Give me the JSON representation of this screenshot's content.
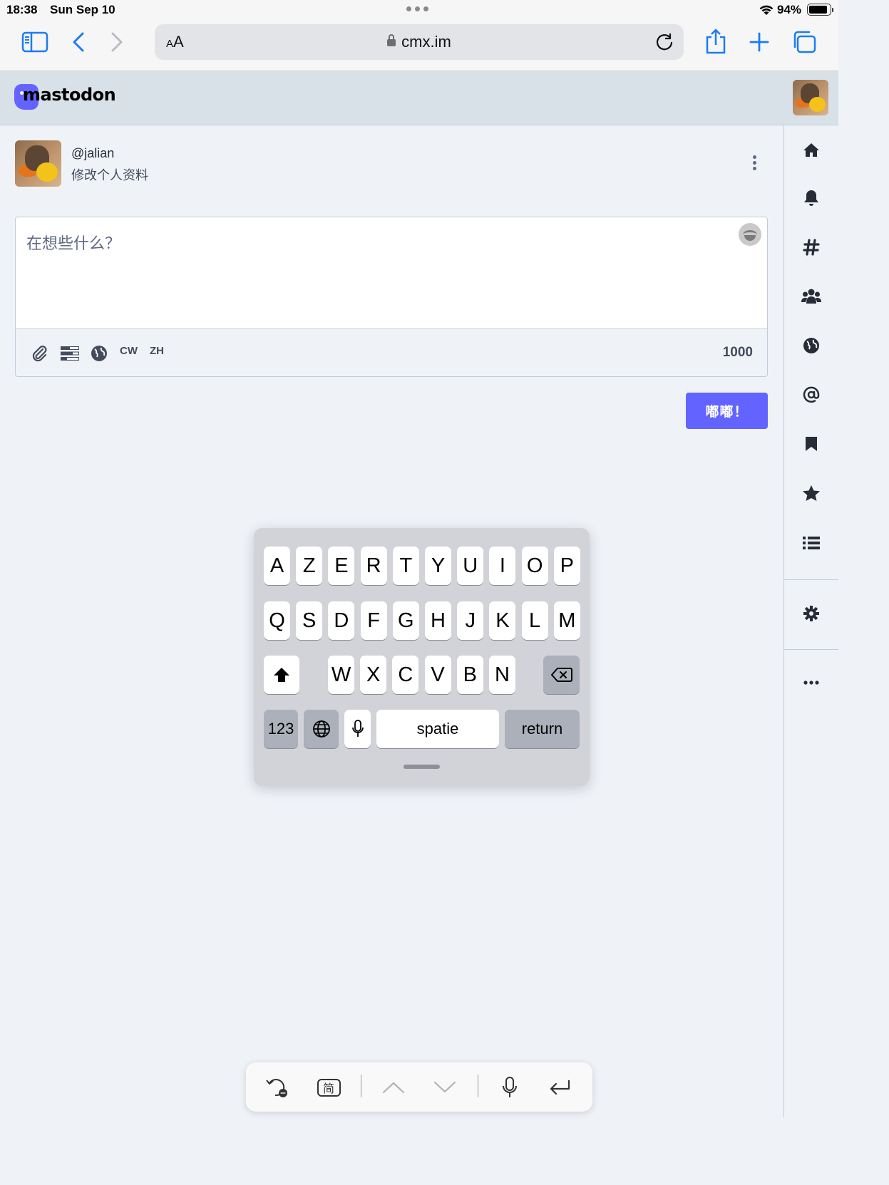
{
  "status_bar": {
    "time": "18:38",
    "date": "Sun Sep 10",
    "battery_pct": "94%",
    "battery_level": 0.94
  },
  "safari": {
    "text_size_label_small": "A",
    "text_size_label_large": "A",
    "domain": "cmx.im",
    "icons": [
      "sidebar-icon",
      "back-icon",
      "forward-icon",
      "lock-icon",
      "reload-icon",
      "share-icon",
      "new-tab-icon",
      "tabs-icon"
    ]
  },
  "mastodon": {
    "logo_text": "mastodon",
    "brand_color": "#6364ff"
  },
  "account": {
    "handle": "@jalian",
    "edit_profile": "修改个人资料"
  },
  "compose": {
    "placeholder": "在想些什么？",
    "cw_label": "CW",
    "lang_label": "ZH",
    "char_counter": "1000",
    "submit_label": "嘟嘟！",
    "option_icons": [
      "paperclip-icon",
      "poll-icon",
      "globe-icon"
    ]
  },
  "right_nav": {
    "items": [
      "home-icon",
      "bell-icon",
      "hashtag-icon",
      "users-icon",
      "globe-icon",
      "at-icon",
      "bookmark-icon",
      "star-icon",
      "list-icon",
      "gear-icon",
      "ellipsis-icon"
    ]
  },
  "keyboard": {
    "row1": [
      "A",
      "Z",
      "E",
      "R",
      "T",
      "Y",
      "U",
      "I",
      "O",
      "P"
    ],
    "row2": [
      "Q",
      "S",
      "D",
      "F",
      "G",
      "H",
      "J",
      "K",
      "L",
      "M"
    ],
    "row3": [
      "W",
      "X",
      "C",
      "V",
      "B",
      "N"
    ],
    "numbers_label": "123",
    "space_label": "spatie",
    "return_label": "return"
  },
  "shortcut_bar": {
    "simplified_label": "简",
    "icons": [
      "undo-more-icon",
      "simplified-icon",
      "chevron-up-icon",
      "chevron-down-icon",
      "mic-icon",
      "return-icon"
    ]
  }
}
